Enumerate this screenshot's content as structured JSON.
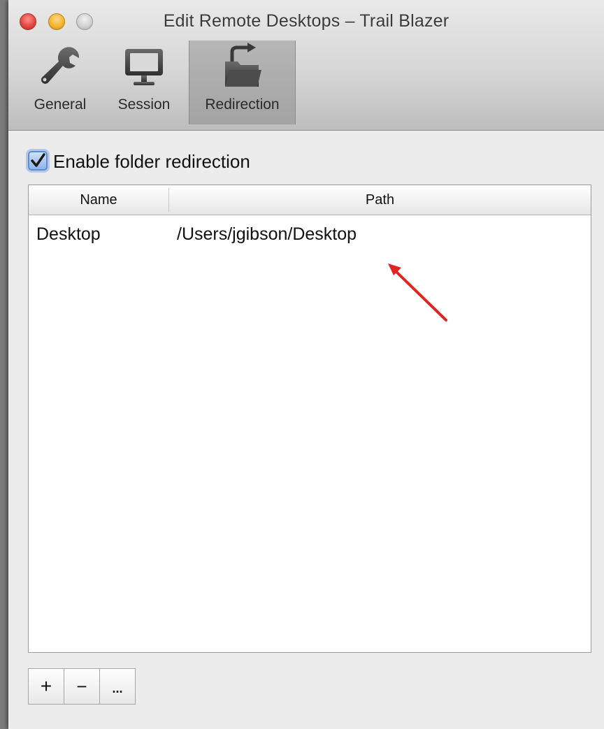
{
  "window": {
    "title": "Edit Remote Desktops – Trail Blazer"
  },
  "toolbar": {
    "items": [
      {
        "label": "General",
        "icon": "wrench-icon"
      },
      {
        "label": "Session",
        "icon": "monitor-icon"
      },
      {
        "label": "Redirection",
        "icon": "folder-redirect-icon",
        "selected": true
      }
    ]
  },
  "redirection": {
    "enable_label": "Enable folder redirection",
    "enabled": true,
    "columns": [
      "Name",
      "Path"
    ],
    "rows": [
      {
        "name": "Desktop",
        "path": "/Users/jgibson/Desktop"
      }
    ],
    "buttons": {
      "add": "+",
      "remove": "−",
      "more": "..."
    }
  },
  "annotation": {
    "color": "#e0241f"
  }
}
